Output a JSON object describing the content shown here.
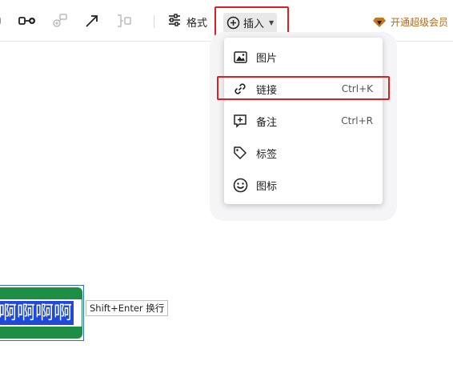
{
  "toolbar": {
    "format_label": "格式",
    "insert_label": "插入",
    "vip_label": "开通超级会员",
    "icons": [
      "node-minus-icon",
      "connect-node-icon",
      "subnode-icon",
      "arrow-line-icon",
      "bracket-icon",
      "sliders-icon",
      "plus-circle-icon",
      "diamond-icon"
    ]
  },
  "insert_menu": {
    "items": [
      {
        "label": "图片",
        "shortcut": "",
        "icon": "image-icon"
      },
      {
        "label": "链接",
        "shortcut": "Ctrl+K",
        "icon": "link-icon"
      },
      {
        "label": "备注",
        "shortcut": "Ctrl+R",
        "icon": "note-icon"
      },
      {
        "label": "标签",
        "shortcut": "",
        "icon": "tag-icon"
      },
      {
        "label": "图标",
        "shortcut": "",
        "icon": "emoji-icon"
      }
    ]
  },
  "canvas": {
    "node_text": "啊啊啊啊",
    "tooltip": "Shift+Enter 换行"
  },
  "colors": {
    "highlight": "#e21d1d",
    "node_green": "#1e8e45",
    "selection_blue": "#1f49d8",
    "vip_text": "#b06a1c"
  }
}
